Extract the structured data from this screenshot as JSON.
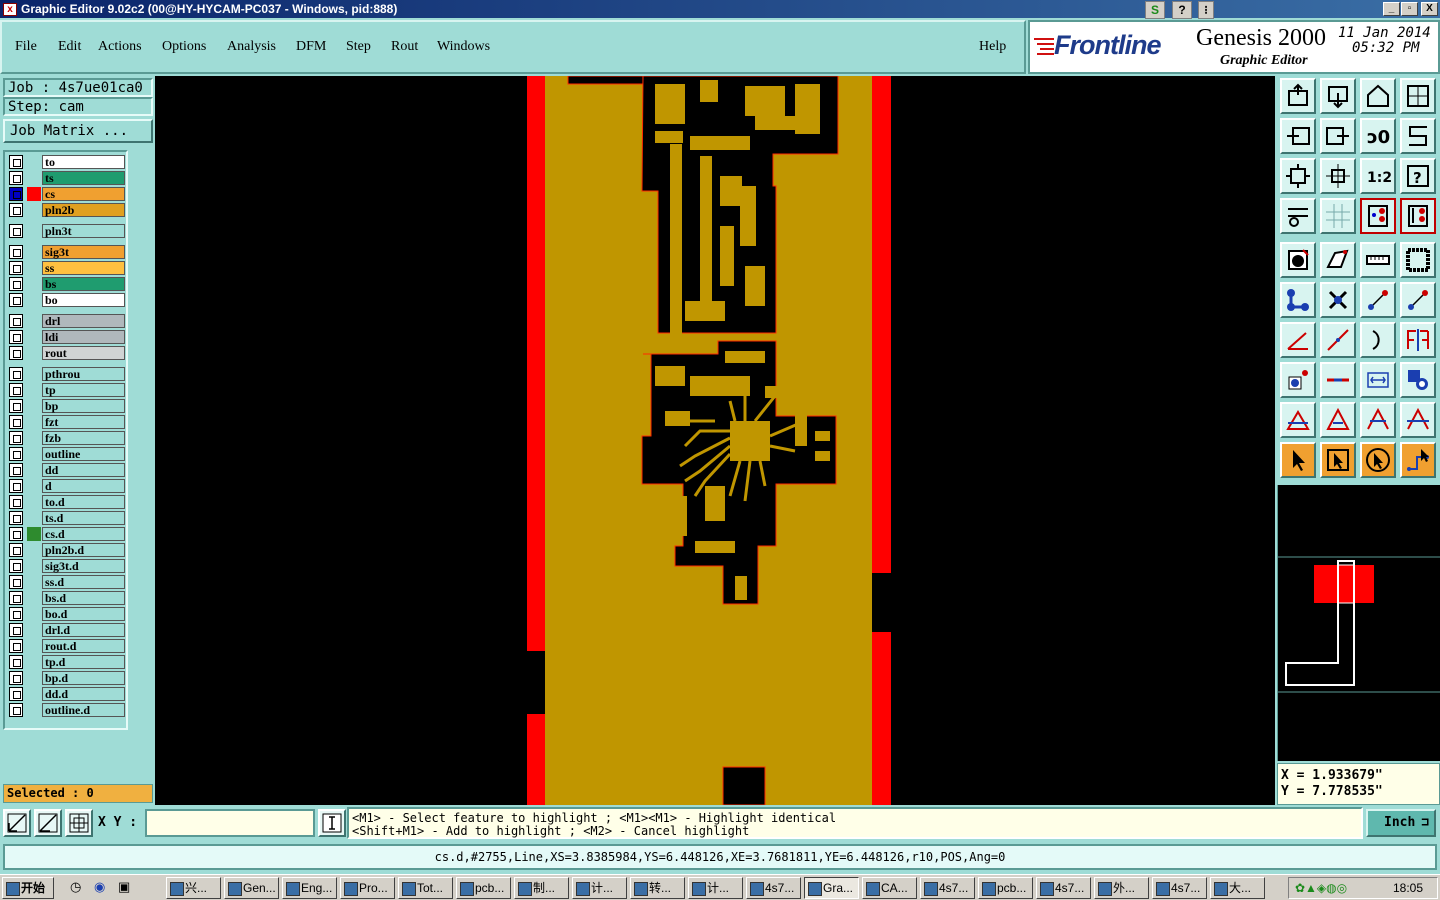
{
  "window": {
    "title": "Graphic Editor 9.02c2 (00@HY-HYCAM-PC037 - Windows, pid:888)",
    "controls": [
      "_",
      "▫",
      "X"
    ]
  },
  "menu": [
    "File",
    "Edit",
    "Actions",
    "Options",
    "Analysis",
    "DFM",
    "Step",
    "Rout",
    "Windows"
  ],
  "help_label": "Help",
  "brand": {
    "logo": "Frontline",
    "product": "Genesis 2000",
    "subtitle": "Graphic Editor",
    "date": "11 Jan 2014",
    "time": "05:32 PM"
  },
  "job": {
    "job_line": "Job : 4s7ue01ca0",
    "step_line": "Step: cam",
    "matrix_button": "Job Matrix ..."
  },
  "layers": [
    {
      "name": "to",
      "color": "#ffffff",
      "marker": ""
    },
    {
      "name": "ts",
      "color": "#1f9c6f",
      "marker": ""
    },
    {
      "name": "cs",
      "color": "#f0a030",
      "marker": "#ff0000",
      "work": true
    },
    {
      "name": "pln2b",
      "color": "#e0a020",
      "marker": ""
    },
    {
      "name": "pln3t",
      "color": "#9fdcd6",
      "marker": ""
    },
    {
      "name": "sig3t",
      "color": "#f0a030",
      "marker": ""
    },
    {
      "name": "ss",
      "color": "#ffc040",
      "marker": ""
    },
    {
      "name": "bs",
      "color": "#1f9c6f",
      "marker": ""
    },
    {
      "name": "bo",
      "color": "#ffffff",
      "marker": ""
    },
    {
      "name": "drl",
      "color": "#b0b8bc",
      "marker": ""
    },
    {
      "name": "ldi",
      "color": "#b0b8bc",
      "marker": ""
    },
    {
      "name": "rout",
      "color": "#d0d4d4",
      "marker": ""
    },
    {
      "name": "pthrou",
      "color": "#9fdcd6",
      "marker": ""
    },
    {
      "name": "tp",
      "color": "#9fdcd6",
      "marker": ""
    },
    {
      "name": "bp",
      "color": "#9fdcd6",
      "marker": ""
    },
    {
      "name": "fzt",
      "color": "#9fdcd6",
      "marker": ""
    },
    {
      "name": "fzb",
      "color": "#9fdcd6",
      "marker": ""
    },
    {
      "name": "outline",
      "color": "#9fdcd6",
      "marker": ""
    },
    {
      "name": "dd",
      "color": "#9fdcd6",
      "marker": ""
    },
    {
      "name": "d",
      "color": "#9fdcd6",
      "marker": ""
    },
    {
      "name": "to.d",
      "color": "#9fdcd6",
      "marker": ""
    },
    {
      "name": "ts.d",
      "color": "#9fdcd6",
      "marker": ""
    },
    {
      "name": "cs.d",
      "color": "#9fdcd6",
      "marker": "#2e8b2e"
    },
    {
      "name": "pln2b.d",
      "color": "#9fdcd6",
      "marker": ""
    },
    {
      "name": "sig3t.d",
      "color": "#9fdcd6",
      "marker": ""
    },
    {
      "name": "ss.d",
      "color": "#9fdcd6",
      "marker": ""
    },
    {
      "name": "bs.d",
      "color": "#9fdcd6",
      "marker": ""
    },
    {
      "name": "bo.d",
      "color": "#9fdcd6",
      "marker": ""
    },
    {
      "name": "drl.d",
      "color": "#9fdcd6",
      "marker": ""
    },
    {
      "name": "rout.d",
      "color": "#9fdcd6",
      "marker": ""
    },
    {
      "name": "tp.d",
      "color": "#9fdcd6",
      "marker": ""
    },
    {
      "name": "bp.d",
      "color": "#9fdcd6",
      "marker": ""
    },
    {
      "name": "dd.d",
      "color": "#9fdcd6",
      "marker": ""
    },
    {
      "name": "outline.d",
      "color": "#9fdcd6",
      "marker": ""
    }
  ],
  "selected_label": "Selected : 0",
  "coords": {
    "x": "X = 1.933679\"",
    "y": "Y = 7.778535\""
  },
  "xy_label": "X Y :",
  "xy_value": "",
  "hint_line1": "<M1> - Select feature to highlight ; <M1><M1> - Highlight identical",
  "hint_line2": "<Shift+M1> - Add to highlight ; <M2> - Cancel highlight",
  "unit": "Inch",
  "feature_info": "cs.d,#2755,Line,XS=3.8385984,YS=6.448126,XE=3.7681811,YE=6.448126,r10,POS,Ang=0",
  "taskbar": {
    "start": "开始",
    "items": [
      "兴...",
      "Gen...",
      "Eng...",
      "Pro...",
      "Tot...",
      "pcb...",
      "制...",
      "计...",
      "转...",
      "计...",
      "4s7...",
      "Gra...",
      "CA...",
      "4s7...",
      "pcb...",
      "4s7...",
      "外...",
      "4s7...",
      "大..."
    ],
    "active_index": 11,
    "clock": "18:05"
  },
  "colors": {
    "copper": "#c09600",
    "board_edge": "#ff0000",
    "background": "#9fdcd6"
  }
}
